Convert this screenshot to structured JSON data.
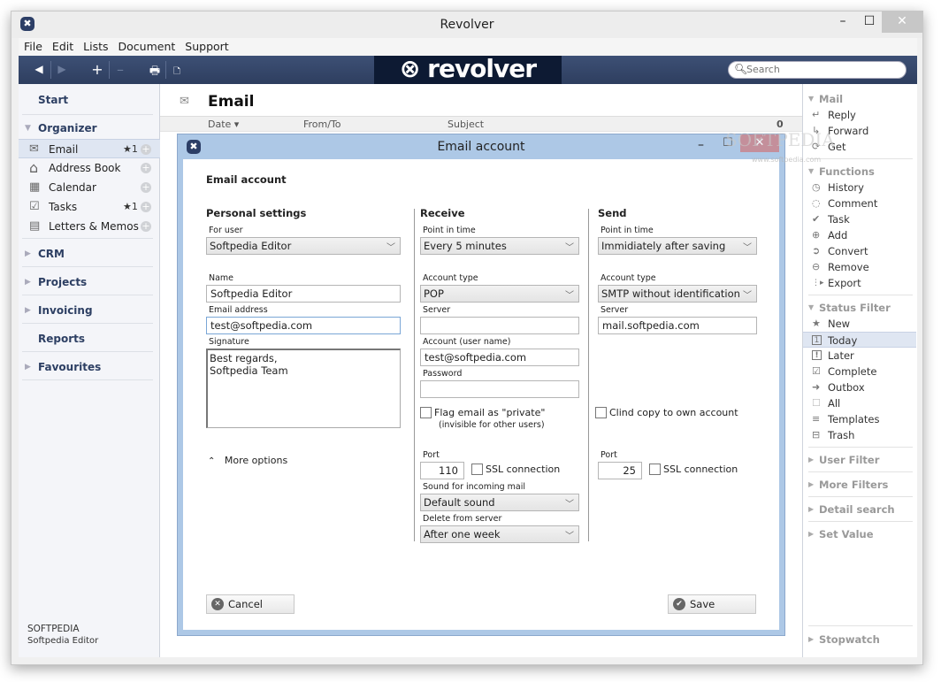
{
  "window": {
    "title": "Revolver",
    "app_icon": "revolver-icon",
    "minimize": "–",
    "maximize": "☐",
    "close": "✕"
  },
  "menu": [
    "File",
    "Edit",
    "Lists",
    "Document",
    "Support"
  ],
  "toolbar": {
    "back": "◀",
    "forward": "▶",
    "add": "+",
    "remove": "–",
    "print": "🖶",
    "note": "🗅",
    "logo": "⊗ revolver",
    "search_placeholder": "Search"
  },
  "sidebar": {
    "start": "Start",
    "organizer": "Organizer",
    "items": [
      {
        "label": "Email",
        "icon": "envelope-icon",
        "glyph": "✉",
        "badge": "★1"
      },
      {
        "label": "Address Book",
        "icon": "house-icon",
        "glyph": "⌂",
        "badge": ""
      },
      {
        "label": "Calendar",
        "icon": "calendar-icon",
        "glyph": "▦",
        "badge": ""
      },
      {
        "label": "Tasks",
        "icon": "checkbox-icon",
        "glyph": "☑",
        "badge": "★1"
      },
      {
        "label": "Letters & Memos",
        "icon": "document-icon",
        "glyph": "▤",
        "badge": ""
      }
    ],
    "sections": [
      "CRM",
      "Projects",
      "Invoicing",
      "Reports",
      "Favourites"
    ],
    "footer": {
      "company": "SOFTPEDIA",
      "user": "Softpedia Editor"
    }
  },
  "main": {
    "title": "Email",
    "columns": {
      "date": "Date ▾",
      "from_to": "From/To",
      "subject": "Subject",
      "count": "0"
    }
  },
  "rightbar": {
    "mail": {
      "title": "Mail",
      "items": [
        {
          "label": "Reply",
          "glyph": "↵"
        },
        {
          "label": "Forward",
          "glyph": "↳"
        },
        {
          "label": "Get",
          "glyph": "⟳"
        }
      ]
    },
    "functions": {
      "title": "Functions",
      "items": [
        {
          "label": "History",
          "glyph": "◷"
        },
        {
          "label": "Comment",
          "glyph": "◌"
        },
        {
          "label": "Task",
          "glyph": "✔"
        },
        {
          "label": "Add",
          "glyph": "⊕"
        },
        {
          "label": "Convert",
          "glyph": "➲"
        },
        {
          "label": "Remove",
          "glyph": "⊖"
        },
        {
          "label": "Export",
          "glyph": "⋮▸"
        }
      ]
    },
    "status": {
      "title": "Status Filter",
      "items": [
        {
          "label": "New",
          "glyph": "★"
        },
        {
          "label": "Today",
          "glyph": "1"
        },
        {
          "label": "Later",
          "glyph": "!"
        },
        {
          "label": "Complete",
          "glyph": "☑"
        },
        {
          "label": "Outbox",
          "glyph": "➜"
        },
        {
          "label": "All",
          "glyph": "☐"
        },
        {
          "label": "Templates",
          "glyph": "≡"
        },
        {
          "label": "Trash",
          "glyph": "⊟"
        }
      ]
    },
    "collapsed": [
      "User Filter",
      "More Filters",
      "Detail search",
      "Set Value"
    ],
    "stopwatch": "Stopwatch"
  },
  "dialog": {
    "title": "Email account",
    "heading": "Email account",
    "personal": {
      "title": "Personal settings",
      "for_user_label": "For user",
      "for_user": "Softpedia Editor",
      "name_label": "Name",
      "name": "Softpedia Editor",
      "email_label": "Email address",
      "email": "test@softpedia.com",
      "signature_label": "Signature",
      "signature": "Best regards,\nSoftpedia Team",
      "more_options": "More options"
    },
    "receive": {
      "title": "Receive",
      "point_label": "Point in time",
      "point": "Every 5 minutes",
      "type_label": "Account type",
      "type": "POP",
      "server_label": "Server",
      "server": "",
      "account_label": "Account (user name)",
      "account": "test@softpedia.com",
      "password_label": "Password",
      "password": "",
      "flag_label": "Flag email as \"private\"",
      "flag_note": "(invisible for other users)",
      "port_label": "Port",
      "port": "110",
      "ssl_label": "SSL connection",
      "sound_label": "Sound for incoming mail",
      "sound": "Default sound",
      "delete_label": "Delete from server",
      "delete": "After one week"
    },
    "send": {
      "title": "Send",
      "point_label": "Point in time",
      "point": "Immidiately after saving",
      "type_label": "Account type",
      "type": "SMTP without identification",
      "server_label": "Server",
      "server": "mail.softpedia.com",
      "copy_label": "Clind copy to own account",
      "port_label": "Port",
      "port": "25",
      "ssl_label": "SSL connection"
    },
    "cancel": "Cancel",
    "save": "Save"
  },
  "watermark": {
    "text": "SOFTPEDIA",
    "url": "www.softpedia.com"
  }
}
